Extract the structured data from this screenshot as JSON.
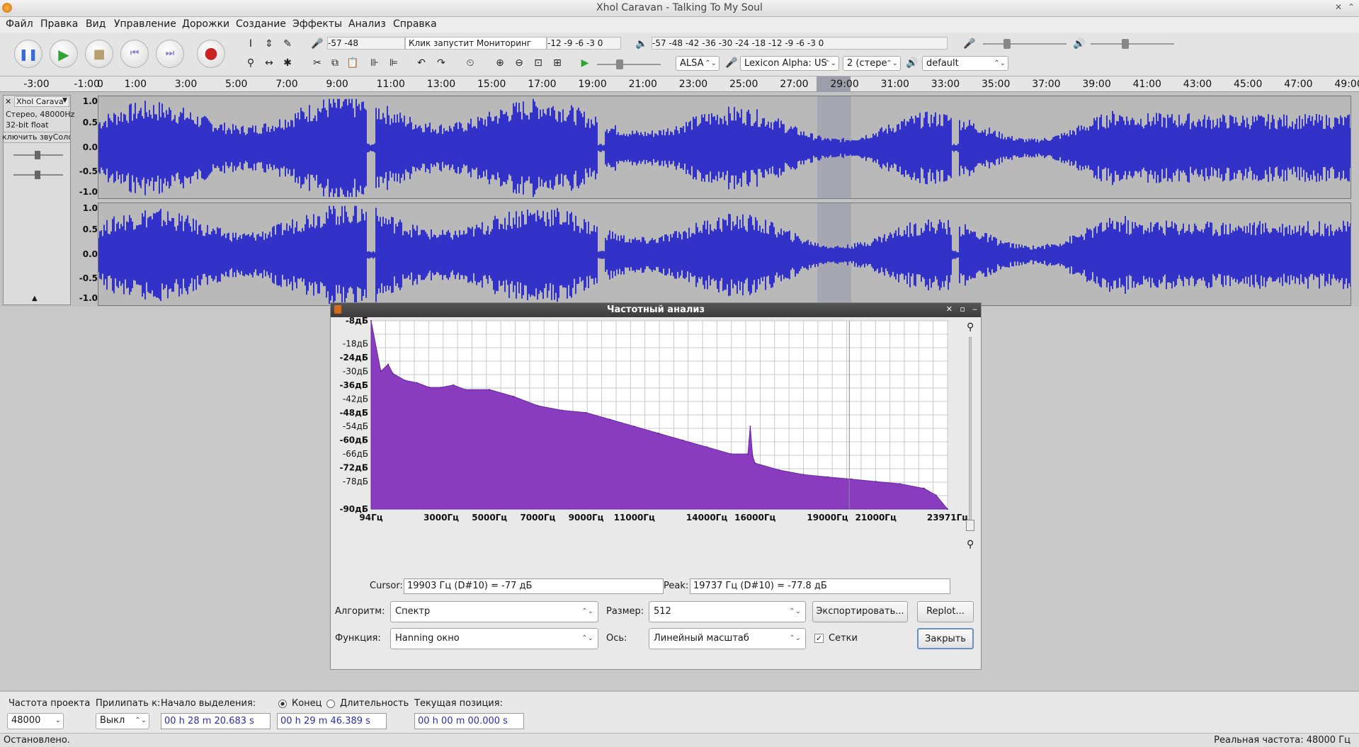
{
  "window": {
    "title": "Xhol Caravan - Talking To My Soul"
  },
  "menu": [
    "Файл",
    "Правка",
    "Вид",
    "Управление",
    "Дорожки",
    "Создание",
    "Эффекты",
    "Анализ",
    "Справка"
  ],
  "toolbar": {
    "rec_meter_ticks": "-57          -48",
    "monitor_label": "Клик запустит Мониторинг",
    "rec_meter_right": "-12 -9 -6 -3 0",
    "play_meter_ticks": "-57     -48     -42     -36     -30     -24     -18     -12 -9  -6  -3 0",
    "host": "ALSA",
    "input_device": "Lexicon Alpha: US",
    "channels": "2 (стере",
    "output_device": "default"
  },
  "ruler": {
    "ticks": [
      "-3:00",
      "-1:00",
      "0",
      "1:00",
      "3:00",
      "5:00",
      "7:00",
      "9:00",
      "11:00",
      "13:00",
      "15:00",
      "17:00",
      "19:00",
      "21:00",
      "23:00",
      "25:00",
      "27:00",
      "29:00",
      "31:00",
      "33:00",
      "35:00",
      "37:00",
      "39:00",
      "41:00",
      "43:00",
      "45:00",
      "47:00",
      "49:00"
    ]
  },
  "track": {
    "name": "Xhol Carava",
    "info1": "Стерео, 48000Hz",
    "info2": "32-bit float",
    "mute_solo": "ключить звуСоло",
    "scale": [
      "1.0",
      "0.5",
      "0.0",
      "-0.5",
      "-1.0"
    ],
    "wave_color": "#3232c8",
    "selection_color": "#a7a7b3"
  },
  "dialog": {
    "title": "Частотный анализ",
    "y_ticks": [
      "-8дБ",
      "-18дБ",
      "-24дБ",
      "-30дБ",
      "-36дБ",
      "-42дБ",
      "-48дБ",
      "-54дБ",
      "-60дБ",
      "-66дБ",
      "-72дБ",
      "-78дБ",
      "-90дБ"
    ],
    "x_ticks": [
      "94Гц",
      "3000Гц",
      "5000Гц",
      "7000Гц",
      "9000Гц",
      "11000Гц",
      "14000Гц",
      "16000Гц",
      "19000Гц",
      "21000Гц",
      "23971Гц"
    ],
    "cursor_label": "Cursor:",
    "cursor_value": "19903 Гц (D#10) = -77 дБ",
    "peak_label": "Peak:",
    "peak_value": "19737 Гц (D#10) = -77.8 дБ",
    "algorithm_label": "Алгоритм:",
    "algorithm_value": "Спектр",
    "size_label": "Размер:",
    "size_value": "512",
    "export_button": "Экспортировать...",
    "replot_button": "Replot...",
    "function_label": "Функция:",
    "function_value": "Hanning окно",
    "axis_label": "Ось:",
    "axis_value": "Линейный масштаб",
    "grids_label": "Сетки",
    "grids_checked": true,
    "close_button": "Закрыть",
    "spectrum_color": "#8a3cbf"
  },
  "chart_data": {
    "type": "area",
    "x": [
      94,
      500,
      800,
      1000,
      1500,
      2000,
      2500,
      3000,
      3500,
      4000,
      5000,
      6000,
      7000,
      8000,
      9000,
      10000,
      11000,
      12000,
      13000,
      14000,
      15000,
      15700,
      15800,
      15900,
      16000,
      17000,
      18000,
      19000,
      20000,
      21000,
      22000,
      23000,
      23500,
      23971
    ],
    "y": [
      -8,
      -30,
      -27,
      -31,
      -34,
      -35,
      -37,
      -37,
      -36,
      -38,
      -38,
      -41,
      -45,
      -47,
      -48,
      -51,
      -54,
      -57,
      -60,
      -63,
      -66,
      -66,
      -54,
      -67,
      -70,
      -73,
      -75,
      -76,
      -77,
      -78,
      -79,
      -81,
      -84,
      -90
    ],
    "xlim": [
      94,
      23971
    ],
    "ylim": [
      -90,
      -8
    ],
    "xlabel": "",
    "ylabel": "",
    "grid": true
  },
  "selection_bar": {
    "rate_label": "Частота проекта",
    "rate_value": "48000",
    "snap_label": "Прилипать к:",
    "snap_value": "Выкл",
    "sel_start_label": "Начало выделения:",
    "end_label": "Конец",
    "length_label": "Длительность",
    "position_label": "Текущая позиция:",
    "sel_start": "00 h 28 m 20.683 s",
    "sel_end": "00 h 29 m 46.389 s",
    "position": "00 h 00 m 00.000 s"
  },
  "status": {
    "left": "Остановлено.",
    "right": "Реальная частота: 48000 Гц"
  }
}
